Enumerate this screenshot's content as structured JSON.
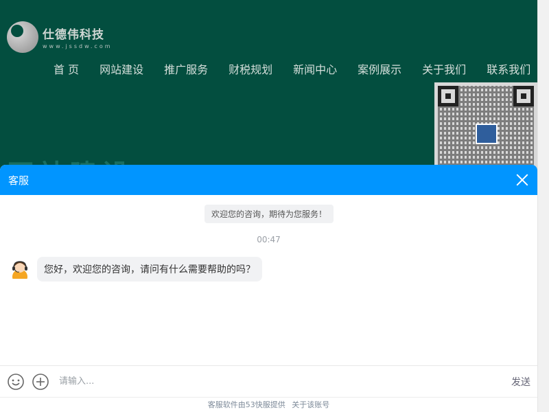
{
  "site": {
    "logo_name": "仕德伟科技",
    "logo_url": "www.jssdw.com",
    "nav": [
      "首 页",
      "网站建设",
      "推广服务",
      "财税规划",
      "新闻中心",
      "案例展示",
      "关于我们",
      "联系我们"
    ],
    "big_title": "网站建设"
  },
  "chat": {
    "title": "客服",
    "welcome": "欢迎您的咨询，期待为您服务！",
    "time": "00:47",
    "message": "您好，欢迎您的咨询，请问有什么需要帮助的吗？",
    "input_placeholder": "请输入...",
    "send_label": "发送",
    "footer_provider": "客服软件由53快服提供",
    "footer_account": "关于该账号"
  },
  "colors": {
    "header": "#0195ff",
    "site_bg": "#034e3f"
  }
}
